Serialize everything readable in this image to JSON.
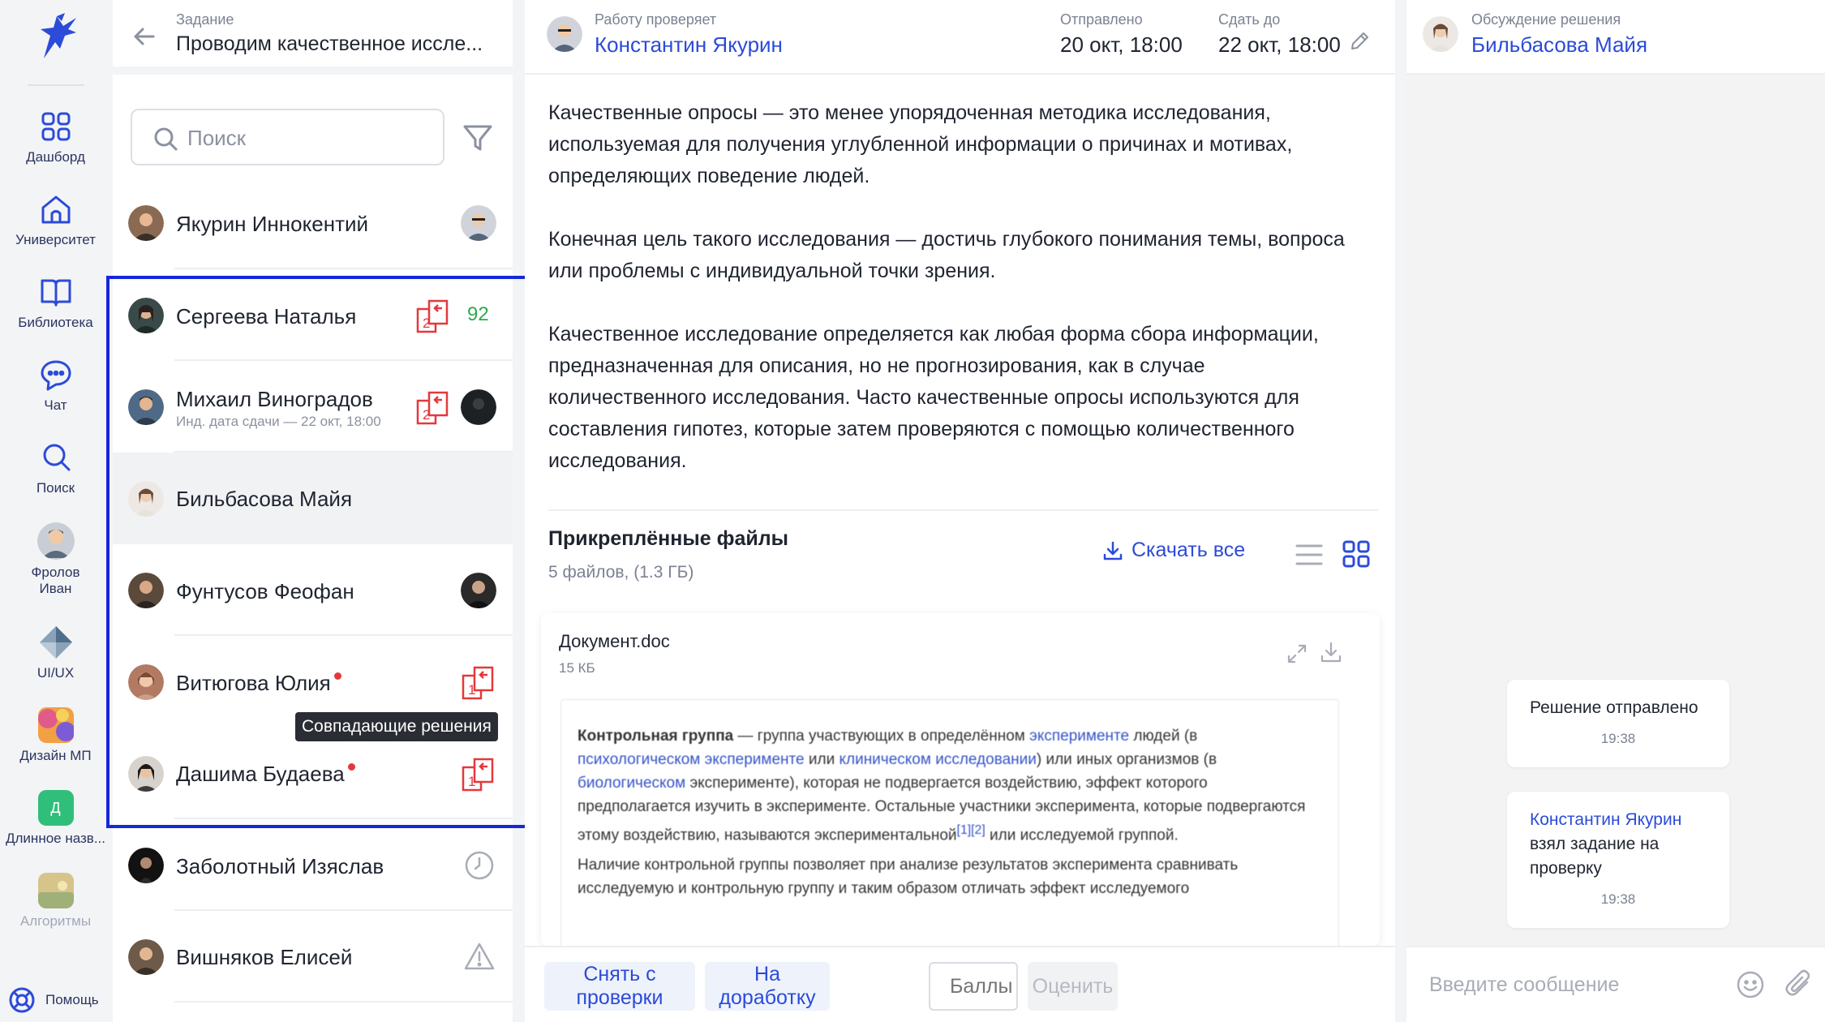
{
  "nav": {
    "items": [
      {
        "label": "Дашборд",
        "icon": "grid-icon"
      },
      {
        "label": "Университет",
        "icon": "home-icon"
      },
      {
        "label": "Библиотека",
        "icon": "book-icon"
      },
      {
        "label": "Чат",
        "icon": "chat-icon"
      },
      {
        "label": "Поиск",
        "icon": "search-icon"
      },
      {
        "label": "Фролов Иван",
        "icon": "avatar"
      },
      {
        "label": "UI/UX",
        "icon": "course-icon"
      },
      {
        "label": "Дизайн МП",
        "icon": "course-icon"
      },
      {
        "label": "Длинное назв...",
        "icon": "course-icon",
        "letter": "Д"
      },
      {
        "label": "Алгоритмы",
        "icon": "course-icon"
      }
    ],
    "help_label": "Помощь"
  },
  "task": {
    "label": "Задание",
    "title": "Проводим качественное иссле..."
  },
  "search": {
    "placeholder": "Поиск"
  },
  "students": [
    {
      "name": "Якурин Иннокентий",
      "sub": "",
      "score": "",
      "matches": "",
      "dot": false
    },
    {
      "name": "Сергеева Наталья",
      "sub": "",
      "score": "92",
      "matches": "2",
      "dot": false
    },
    {
      "name": "Михаил Виноградов",
      "sub": "Инд. дата сдачи — 22 окт, 18:00",
      "score": "",
      "matches": "2",
      "dot": false
    },
    {
      "name": "Бильбасова Майя",
      "sub": "",
      "score": "",
      "matches": "",
      "dot": false
    },
    {
      "name": "Фунтусов Феофан",
      "sub": "",
      "score": "",
      "matches": "",
      "dot": false
    },
    {
      "name": "Витюгова Юлия",
      "sub": "",
      "score": "",
      "matches": "1",
      "dot": true
    },
    {
      "name": "Дашима Будаева",
      "sub": "",
      "score": "",
      "matches": "1",
      "dot": true
    },
    {
      "name": "Заболотный Изяслав",
      "sub": "",
      "score": "",
      "matches": "",
      "status": "clock-icon"
    },
    {
      "name": "Вишняков Елисей",
      "sub": "",
      "score": "",
      "matches": "",
      "status": "warning-icon"
    }
  ],
  "tooltip": "Совпадающие решения",
  "header": {
    "reviewer_label": "Работу проверяет",
    "reviewer_name": "Константин Якурин",
    "sent_label": "Отправлено",
    "sent_value": "20 окт, 18:00",
    "due_label": "Сдать до",
    "due_value": "22 окт, 18:00"
  },
  "content": {
    "paragraphs": [
      "Качественные опросы — это менее упорядоченная методика исследования, используемая для получения углубленной информации о причинах и мотивах, определяющих поведение людей.",
      "Конечная цель такого исследования — достичь глубокого понимания темы, вопроса или проблемы с индивидуальной точки зрения.",
      "Качественное исследование определяется как любая форма сбора информации, предназначенная для описания, но не прогнозирования, как в случае количественного исследования. Часто качественные опросы используются для составления гипотез, которые затем проверяются с помощью количественного исследования."
    ]
  },
  "files": {
    "title": "Прикреплённые файлы",
    "subtitle": "5 файлов, (1.3 ГБ)",
    "download_all": "Скачать все",
    "doc": {
      "name": "Документ.doc",
      "size": "15 КБ",
      "preview": {
        "p1_bold": "Контрольная группа",
        "p1_a": " — группа участвующих в определённом ",
        "p1_link1": "эксперименте",
        "p1_b": " людей (в ",
        "p1_link2": "психологическом эксперименте",
        "p1_c": " или ",
        "p1_link3": "клиническом исследовании",
        "p1_d": ") или иных организмов (в ",
        "p1_link4": "биологическом",
        "p1_e": " эксперименте), которая не подвергается воздействию, эффект которого предполагается изучить в эксперименте. Остальные участники эксперимента, которые подвергаются этому воздействию, называются экспериментальной",
        "p1_ref": "[1][2]",
        "p1_f": " или исследуемой группой.",
        "p2": "Наличие контрольной группы позволяет при анализе результатов эксперимента сравнивать исследуемую и контрольную группу и таким образом отличать эффект исследуемого"
      }
    }
  },
  "actions": {
    "unassign": "Снять с проверки",
    "rework": "На доработку",
    "points_placeholder": "Баллы",
    "grade": "Оценить"
  },
  "chat": {
    "header_label": "Обсуждение решения",
    "header_name": "Бильбасова Майя",
    "messages": [
      {
        "text": "Решение отправлено",
        "time": "19:38"
      },
      {
        "who": "Константин Якурин",
        "text": "взял задание на проверку",
        "time": "19:38"
      }
    ],
    "input_placeholder": "Введите сообщение"
  },
  "colors": {
    "accent": "#2c4bd8",
    "nav_text": "#2a3560",
    "match_red": "#e5383b",
    "score_green": "#2fa84f",
    "highlight_border": "#1528d8"
  }
}
